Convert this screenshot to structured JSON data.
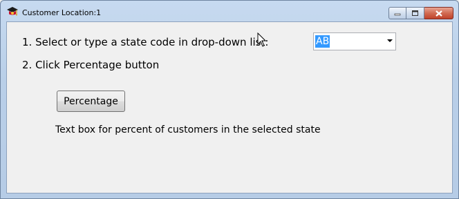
{
  "window": {
    "title": "Customer Location:1",
    "app_icon": "graduation-cap-icon",
    "controls": {
      "minimize_icon": "minimize-icon",
      "maximize_icon": "maximize-icon",
      "close_icon": "close-icon"
    },
    "close_color": "#c7462d"
  },
  "content": {
    "instruction_1": "1. Select or type a state code in drop-down list:",
    "instruction_2": "2. Click Percentage button",
    "state_select": {
      "value": "AB"
    },
    "percentage_button": "Percentage",
    "result_text": "Text box for percent of customers in the selected state"
  },
  "colors": {
    "selection_highlight": "#3399ff",
    "window_frame": "#b9d1ea",
    "client_background": "#f0f0f0"
  }
}
